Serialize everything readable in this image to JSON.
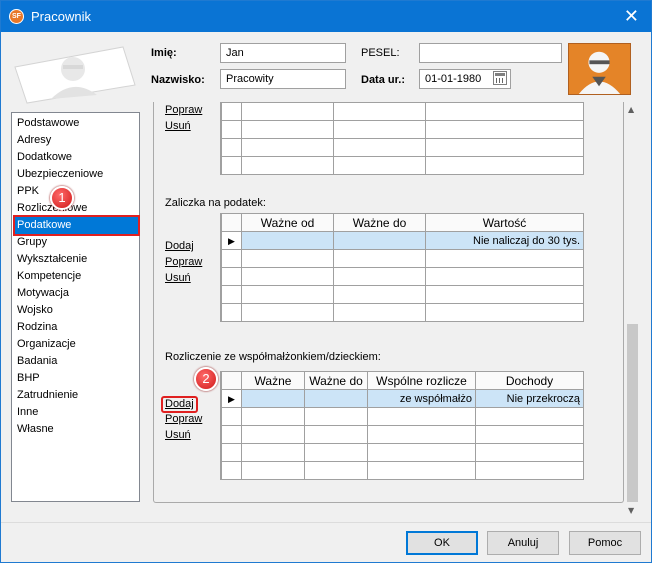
{
  "window": {
    "title": "Pracownik",
    "app_icon_text": "SF"
  },
  "header": {
    "imie_label": "Imię:",
    "imie_value": "Jan",
    "nazwisko_label": "Nazwisko:",
    "nazwisko_value": "Pracowity",
    "pesel_label": "PESEL:",
    "pesel_value": "",
    "data_ur_label": "Data ur.:",
    "data_ur_value": "01-01-1980"
  },
  "sidebar": {
    "items": [
      {
        "label": "Podstawowe"
      },
      {
        "label": "Adresy"
      },
      {
        "label": "Dodatkowe"
      },
      {
        "label": "Ubezpieczeniowe"
      },
      {
        "label": "PPK"
      },
      {
        "label": "Rozliczeniowe"
      },
      {
        "label": "Podatkowe",
        "selected": true
      },
      {
        "label": "Grupy"
      },
      {
        "label": "Wykształcenie"
      },
      {
        "label": "Kompetencje"
      },
      {
        "label": "Motywacja"
      },
      {
        "label": "Wojsko"
      },
      {
        "label": "Rodzina"
      },
      {
        "label": "Organizacje"
      },
      {
        "label": "Badania"
      },
      {
        "label": "BHP"
      },
      {
        "label": "Zatrudnienie"
      },
      {
        "label": "Inne"
      },
      {
        "label": "Własne"
      }
    ]
  },
  "section_top": {
    "popraw": "Popraw",
    "usun": "Usuń"
  },
  "section_zaliczka": {
    "title": "Zaliczka na podatek:",
    "dodaj": "Dodaj",
    "popraw": "Popraw",
    "usun": "Usuń",
    "columns": [
      "Ważne od",
      "Ważne do",
      "Wartość"
    ],
    "rows": [
      [
        "",
        "",
        "Nie naliczaj do 30 tys."
      ]
    ]
  },
  "section_rozliczenie": {
    "title": "Rozliczenie ze współmałżonkiem/dzieckiem:",
    "dodaj": "Dodaj",
    "popraw": "Popraw",
    "usun": "Usuń",
    "columns": [
      "Ważne",
      "Ważne do",
      "Wspólne rozlicze",
      "Dochody"
    ],
    "rows": [
      [
        "",
        "",
        "ze współmałżo",
        "Nie przekroczą"
      ]
    ]
  },
  "annotations": {
    "badge1": "1",
    "badge2": "2",
    "color": "#e02020"
  },
  "footer": {
    "ok": "OK",
    "anuluj": "Anuluj",
    "pomoc": "Pomoc"
  },
  "colors": {
    "titlebar": "#0a74d4",
    "selection": "#0078d7",
    "row_selected": "#cce4f7"
  }
}
